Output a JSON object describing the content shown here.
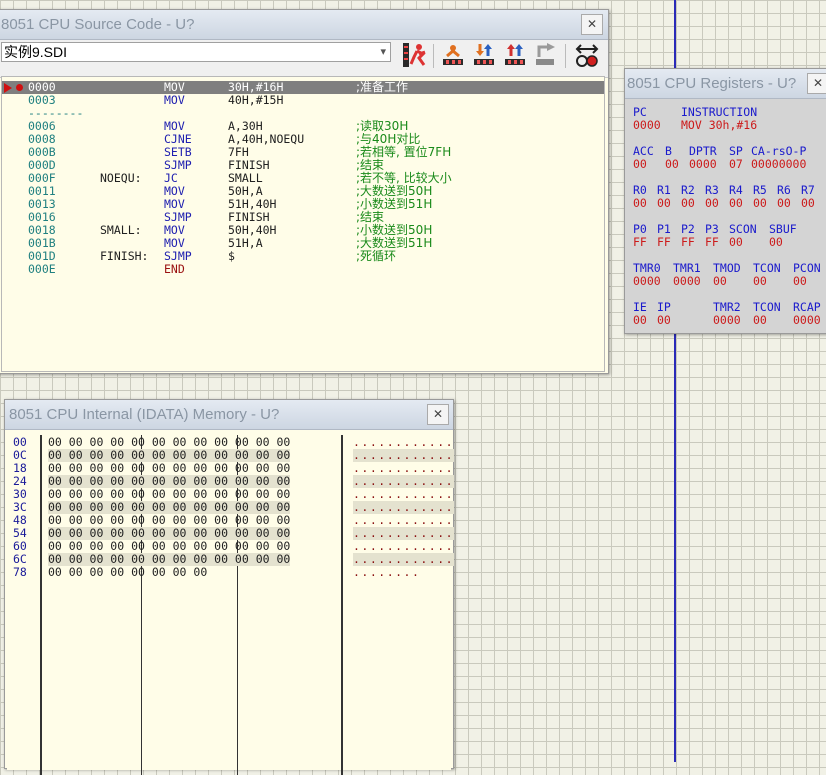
{
  "source": {
    "title": "8051 CPU Source Code - U?",
    "file": "实例9.SDI",
    "lines": [
      {
        "addr": "0000",
        "label": "",
        "mnem": "MOV",
        "ops": "30H,#16H",
        "cmt": ";准备工作",
        "sel": true
      },
      {
        "addr": "0003",
        "label": "",
        "mnem": "MOV",
        "ops": "40H,#15H",
        "cmt": ""
      },
      {
        "addr": "--------",
        "label": "",
        "mnem": "",
        "ops": "",
        "cmt": "",
        "sep": true
      },
      {
        "addr": "0006",
        "label": "",
        "mnem": "MOV",
        "ops": "A,30H",
        "cmt": ";读取30H"
      },
      {
        "addr": "0008",
        "label": "",
        "mnem": "CJNE",
        "ops": "A,40H,NOEQU",
        "cmt": ";与40H对比"
      },
      {
        "addr": "000B",
        "label": "",
        "mnem": "SETB",
        "ops": "7FH",
        "cmt": ";若相等, 置位7FH"
      },
      {
        "addr": "000D",
        "label": "",
        "mnem": "SJMP",
        "ops": "FINISH",
        "cmt": ";结束"
      },
      {
        "addr": "000F",
        "label": "NOEQU:",
        "mnem": "JC",
        "ops": "SMALL",
        "cmt": ";若不等, 比较大小"
      },
      {
        "addr": "0011",
        "label": "",
        "mnem": "MOV",
        "ops": "50H,A",
        "cmt": ";大数送到50H"
      },
      {
        "addr": "0013",
        "label": "",
        "mnem": "MOV",
        "ops": "51H,40H",
        "cmt": ";小数送到51H"
      },
      {
        "addr": "0016",
        "label": "",
        "mnem": "SJMP",
        "ops": "FINISH",
        "cmt": ";结束"
      },
      {
        "addr": "0018",
        "label": "SMALL:",
        "mnem": "MOV",
        "ops": "50H,40H",
        "cmt": ";小数送到50H"
      },
      {
        "addr": "001B",
        "label": "",
        "mnem": "MOV",
        "ops": "51H,A",
        "cmt": ";大数送到51H"
      },
      {
        "addr": "001D",
        "label": "FINISH:",
        "mnem": "SJMP",
        "ops": "$",
        "cmt": ";死循环"
      },
      {
        "addr": "000E",
        "label": "",
        "mnem": "END",
        "ops": "",
        "cmt": "",
        "endline": true
      }
    ],
    "toolbar": [
      "run-icon",
      "step-over-icon",
      "step-into-icon",
      "step-out-icon",
      "run-to-cursor-icon",
      "breakpoint-toggle-icon"
    ]
  },
  "registers": {
    "title": "8051 CPU Registers - U?",
    "rows": [
      {
        "cells": [
          {
            "t": "PC",
            "v": "0000"
          },
          {
            "t": "INSTRUCTION",
            "v": "MOV 30h,#16"
          }
        ]
      },
      {
        "cells": [
          {
            "t": "ACC",
            "v": "00"
          },
          {
            "t": "B",
            "v": "00"
          },
          {
            "t": "DPTR",
            "v": "0000"
          },
          {
            "t": "SP",
            "v": "07"
          },
          {
            "t": "CA-rsO-P",
            "v": "00000000"
          }
        ]
      },
      {
        "cells": [
          {
            "t": "R0",
            "v": "00"
          },
          {
            "t": "R1",
            "v": "00"
          },
          {
            "t": "R2",
            "v": "00"
          },
          {
            "t": "R3",
            "v": "00"
          },
          {
            "t": "R4",
            "v": "00"
          },
          {
            "t": "R5",
            "v": "00"
          },
          {
            "t": "R6",
            "v": "00"
          },
          {
            "t": "R7",
            "v": "00"
          }
        ]
      },
      {
        "cells": [
          {
            "t": "P0",
            "v": "FF"
          },
          {
            "t": "P1",
            "v": "FF"
          },
          {
            "t": "P2",
            "v": "FF"
          },
          {
            "t": "P3",
            "v": "FF"
          },
          {
            "t": "SCON",
            "v": "00"
          },
          {
            "t": "SBUF",
            "v": "00"
          }
        ]
      },
      {
        "cells": [
          {
            "t": "TMR0",
            "v": "0000"
          },
          {
            "t": "TMR1",
            "v": "0000"
          },
          {
            "t": "TMOD",
            "v": "00"
          },
          {
            "t": "TCON",
            "v": "00"
          },
          {
            "t": "PCON",
            "v": "00"
          }
        ]
      },
      {
        "cells": [
          {
            "t": "IE",
            "v": "00"
          },
          {
            "t": "IP",
            "v": "00"
          },
          {
            "t": "TMR2",
            "v": "0000"
          },
          {
            "t": "TCON",
            "v": "00"
          },
          {
            "t": "RCAP",
            "v": "0000"
          }
        ]
      }
    ]
  },
  "memory": {
    "title": "8051 CPU Internal (IDATA) Memory - U?",
    "rows": [
      {
        "addr": "00",
        "bytes": "00 00 00 00 00 00 00 00 00 00 00 00",
        "ascii": "............"
      },
      {
        "addr": "0C",
        "bytes": "00 00 00 00 00 00 00 00 00 00 00 00",
        "ascii": "............"
      },
      {
        "addr": "18",
        "bytes": "00 00 00 00 00 00 00 00 00 00 00 00",
        "ascii": "............"
      },
      {
        "addr": "24",
        "bytes": "00 00 00 00 00 00 00 00 00 00 00 00",
        "ascii": "............"
      },
      {
        "addr": "30",
        "bytes": "00 00 00 00 00 00 00 00 00 00 00 00",
        "ascii": "............"
      },
      {
        "addr": "3C",
        "bytes": "00 00 00 00 00 00 00 00 00 00 00 00",
        "ascii": "............"
      },
      {
        "addr": "48",
        "bytes": "00 00 00 00 00 00 00 00 00 00 00 00",
        "ascii": "............"
      },
      {
        "addr": "54",
        "bytes": "00 00 00 00 00 00 00 00 00 00 00 00",
        "ascii": "............"
      },
      {
        "addr": "60",
        "bytes": "00 00 00 00 00 00 00 00 00 00 00 00",
        "ascii": "............"
      },
      {
        "addr": "6C",
        "bytes": "00 00 00 00 00 00 00 00 00 00 00 00",
        "ascii": "............"
      },
      {
        "addr": "78",
        "bytes": "00 00 00 00 00 00 00 00",
        "ascii": "........"
      }
    ]
  },
  "colors": {
    "accent": "#2a2ab8",
    "register_name": "#1a1acc",
    "register_value": "#cc1a1a",
    "comment": "#1a8a1a",
    "selection": "#7f7f7f"
  }
}
